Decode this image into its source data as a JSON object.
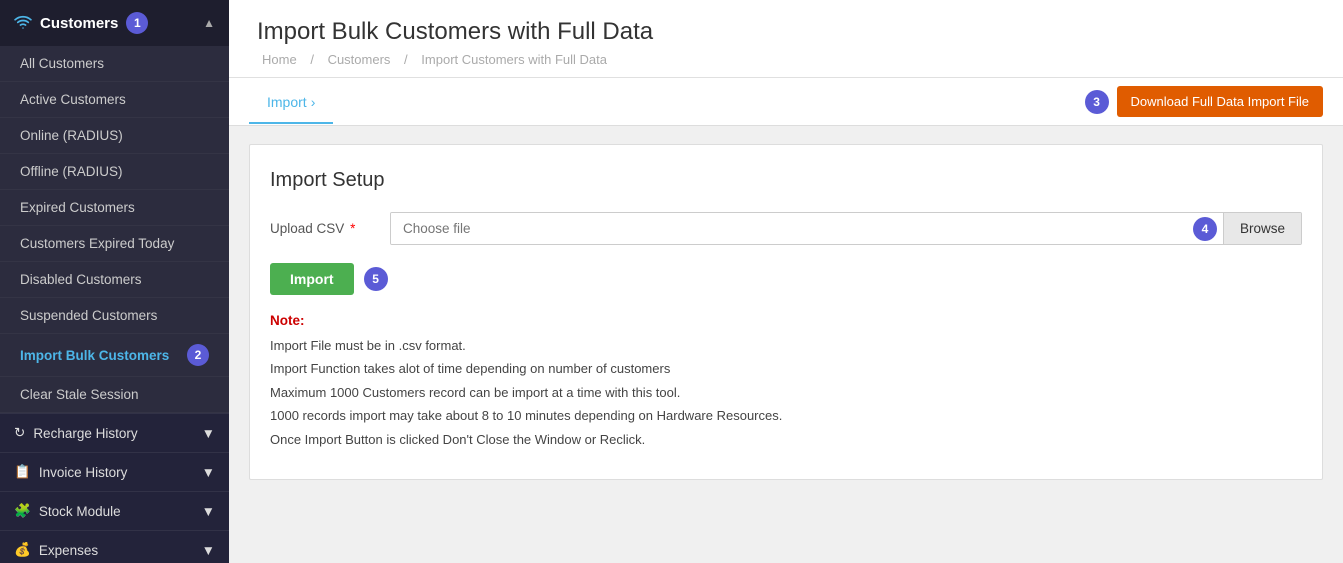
{
  "sidebar": {
    "header": {
      "title": "Customers",
      "badge": "1",
      "icon": "wifi"
    },
    "nav_items": [
      {
        "id": "all-customers",
        "label": "All Customers",
        "active": false
      },
      {
        "id": "active-customers",
        "label": "Active Customers",
        "active": false
      },
      {
        "id": "online-radius",
        "label": "Online (RADIUS)",
        "active": false
      },
      {
        "id": "offline-radius",
        "label": "Offline (RADIUS)",
        "active": false
      },
      {
        "id": "expired-customers",
        "label": "Expired Customers",
        "active": false
      },
      {
        "id": "customers-expired-today",
        "label": "Customers Expired Today",
        "active": false
      },
      {
        "id": "disabled-customers",
        "label": "Disabled Customers",
        "active": false
      },
      {
        "id": "suspended-customers",
        "label": "Suspended Customers",
        "active": false
      },
      {
        "id": "import-bulk-customers",
        "label": "Import Bulk Customers",
        "active": true,
        "badge": "2"
      },
      {
        "id": "clear-stale-session",
        "label": "Clear Stale Session",
        "active": false
      }
    ],
    "sections": [
      {
        "id": "recharge-history",
        "label": "Recharge History",
        "icon": "reload"
      },
      {
        "id": "invoice-history",
        "label": "Invoice History",
        "icon": "invoice"
      },
      {
        "id": "stock-module",
        "label": "Stock Module",
        "icon": "puzzle"
      },
      {
        "id": "expenses",
        "label": "Expenses",
        "icon": "money"
      }
    ]
  },
  "page": {
    "title": "Import Bulk Customers with Full Data",
    "breadcrumb": {
      "home": "Home",
      "customers": "Customers",
      "current": "Import Customers with Full Data"
    }
  },
  "tabs": [
    {
      "id": "import",
      "label": "Import",
      "active": true
    }
  ],
  "toolbar": {
    "download_badge": "3",
    "download_label": "Download Full Data Import File"
  },
  "import_setup": {
    "title": "Import Setup",
    "upload_csv_label": "Upload CSV",
    "file_placeholder": "Choose file",
    "browse_label": "Browse",
    "import_button_label": "Import",
    "import_badge": "5",
    "note_label": "Note:",
    "notes": [
      "Import File must be in .csv format.",
      "Import Function takes alot of time depending on number of customers",
      "Maximum 1000 Customers record can be import at a time with this tool.",
      "1000 records import may take about 8 to 10 minutes depending on Hardware Resources.",
      "Once Import Button is clicked Don't Close the Window or Reclick."
    ]
  },
  "colors": {
    "accent_blue": "#4db6e8",
    "sidebar_bg": "#2c2c3e",
    "badge_purple": "#5b5bd6",
    "btn_orange": "#e05c00",
    "btn_green": "#4caf50",
    "note_red": "#cc0000"
  }
}
